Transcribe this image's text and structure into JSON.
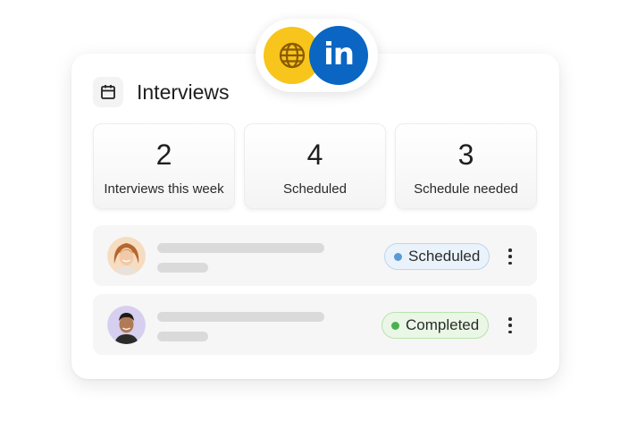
{
  "header": {
    "title": "Interviews",
    "icon": "calendar-icon"
  },
  "stats": [
    {
      "value": "2",
      "label": "Interviews this week"
    },
    {
      "value": "4",
      "label": "Scheduled"
    },
    {
      "value": "3",
      "label": "Schedule needed"
    }
  ],
  "rows": [
    {
      "status": "Scheduled",
      "status_color": "#5a9bd5"
    },
    {
      "status": "Completed",
      "status_color": "#4caf50"
    }
  ],
  "integrations": {
    "globe": "globe-icon",
    "linkedin": "in"
  },
  "colors": {
    "globe_bg": "#f7c51b",
    "linkedin_bg": "#0a66c2"
  }
}
